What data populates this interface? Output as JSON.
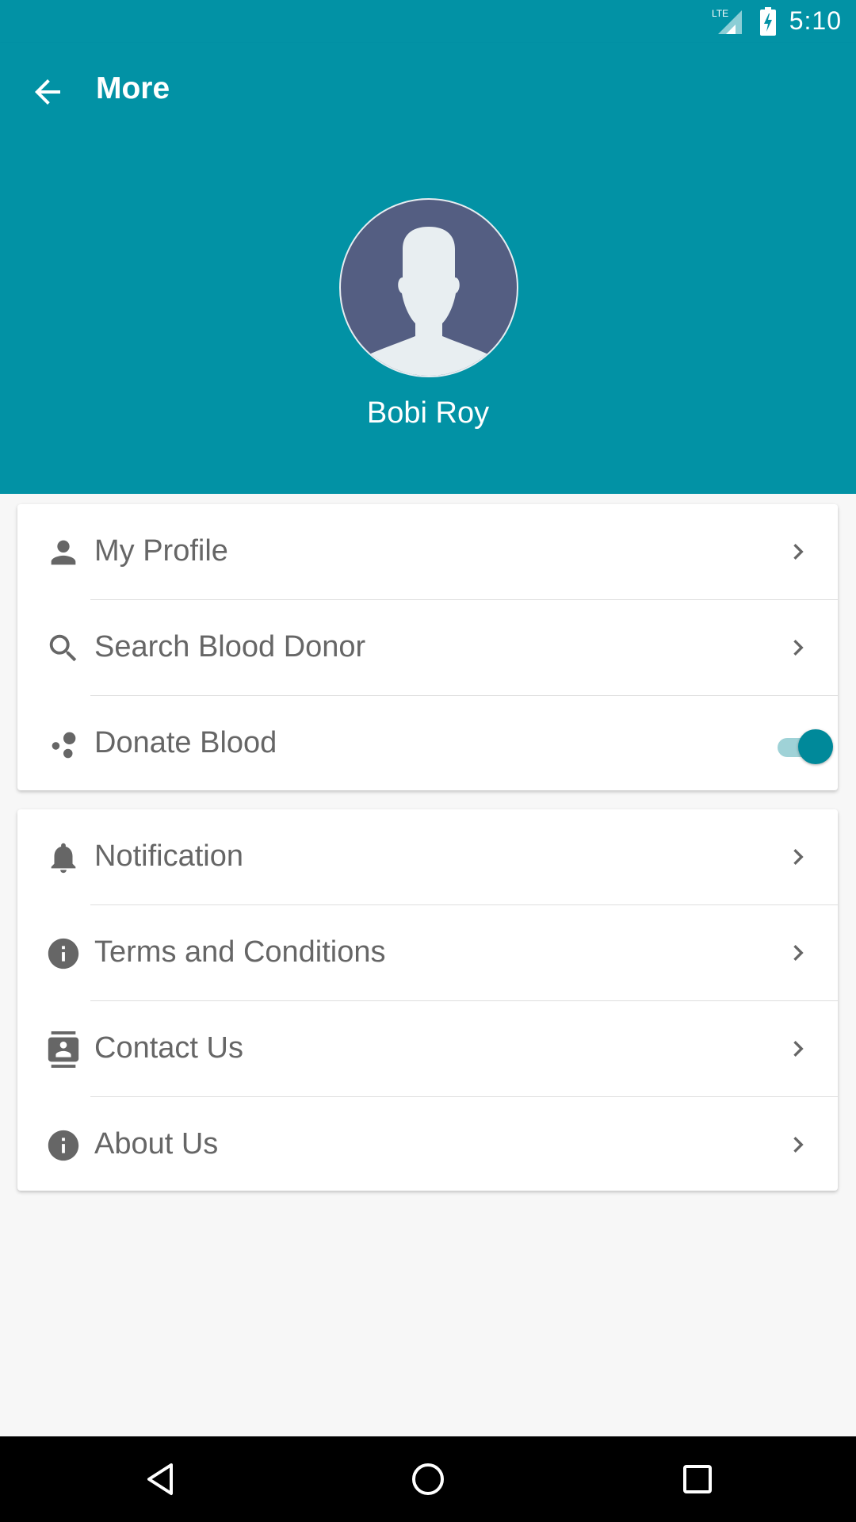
{
  "status_bar": {
    "time": "5:10",
    "network": "LTE",
    "icons": [
      "lte-signal-icon",
      "battery-charging-icon"
    ]
  },
  "app_bar": {
    "title": "More",
    "back_icon": "arrow-back-icon"
  },
  "profile": {
    "name": "Bobi Roy",
    "avatar_icon": "person-silhouette-icon"
  },
  "menu_primary": [
    {
      "label": "My Profile",
      "icon": "person-icon"
    },
    {
      "label": "Search Blood Donor",
      "icon": "search-icon"
    },
    {
      "label": "Donate Blood",
      "icon": "blood-drops-icon",
      "toggle_on": true
    }
  ],
  "menu_secondary": [
    {
      "label": "Notification",
      "icon": "bell-icon"
    },
    {
      "label": "Terms and Conditions",
      "icon": "info-icon"
    },
    {
      "label": "Contact Us",
      "icon": "contacts-icon"
    },
    {
      "label": "About Us",
      "icon": "info-icon"
    }
  ],
  "nav_bar": {
    "icons": [
      "back-triangle-icon",
      "home-circle-icon",
      "recents-square-icon"
    ]
  },
  "colors": {
    "primary": "#0292a5",
    "avatar_bg": "#545e82",
    "toggle_thumb": "#00899a",
    "text": "#666666",
    "background": "#f7f7f7"
  }
}
